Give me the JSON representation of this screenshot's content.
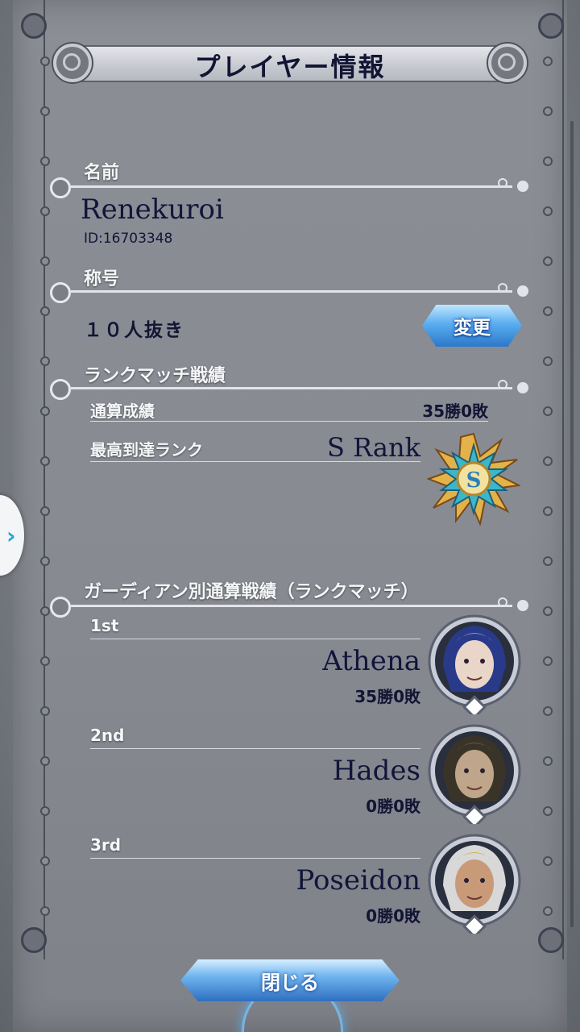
{
  "header": {
    "title": "プレイヤー情報"
  },
  "name_section": {
    "label": "名前",
    "player_name": "Renekuroi",
    "player_id": "ID:16703348"
  },
  "title_section": {
    "label": "称号",
    "value": "１０人抜き",
    "change_button": "変更"
  },
  "rank_section": {
    "label": "ランクマッチ戦績",
    "total_label": "通算成績",
    "total_value": "35勝0敗",
    "highest_label": "最高到達ランク",
    "highest_value": "S Rank",
    "badge_letter": "S"
  },
  "guardian_section": {
    "label": "ガーディアン別通算戦績（ランクマッチ）",
    "entries": [
      {
        "place": "1st",
        "name": "Athena",
        "record": "35勝0敗"
      },
      {
        "place": "2nd",
        "name": "Hades",
        "record": "0勝0敗"
      },
      {
        "place": "3rd",
        "name": "Poseidon",
        "record": "0勝0敗"
      }
    ]
  },
  "footer": {
    "close_button": "閉じる"
  },
  "side_tab": {
    "icon": "chevron-right-icon"
  },
  "colors": {
    "panel": "#888b92",
    "text_dark": "#11153a",
    "button_blue": "#5aaef0",
    "badge_gold": "#e3b34a",
    "badge_teal": "#3fb5c8"
  }
}
